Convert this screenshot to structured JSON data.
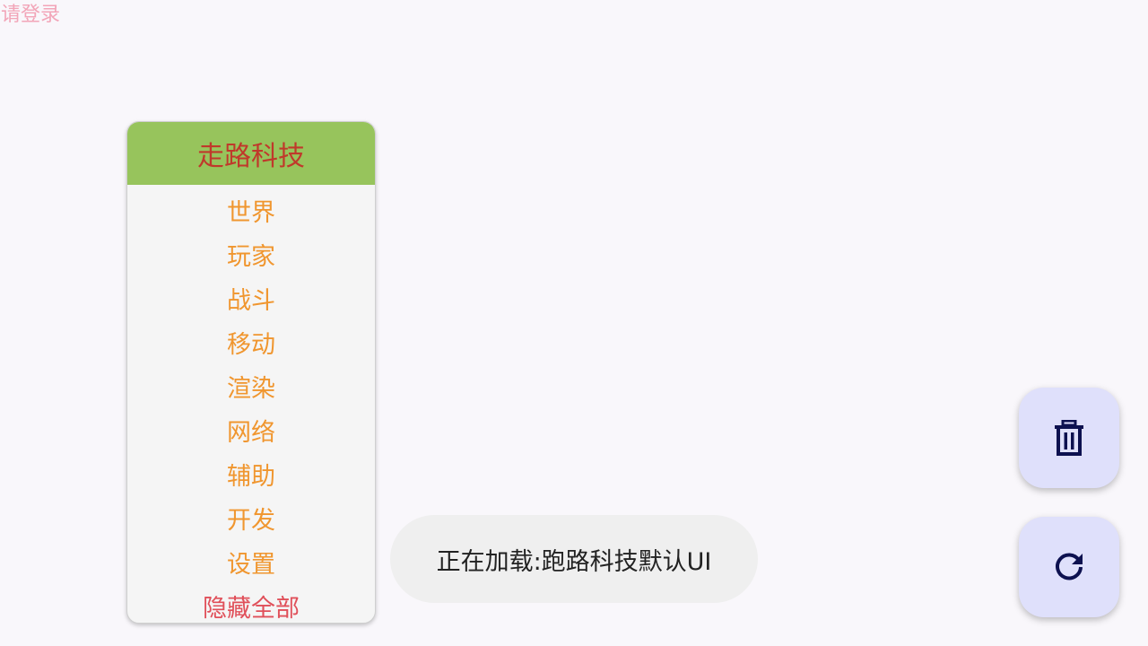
{
  "login_hint": "请登录",
  "menu": {
    "header": "走路科技",
    "items": [
      {
        "label": "世界"
      },
      {
        "label": "玩家"
      },
      {
        "label": "战斗"
      },
      {
        "label": "移动"
      },
      {
        "label": "渲染"
      },
      {
        "label": "网络"
      },
      {
        "label": "辅助"
      },
      {
        "label": "开发"
      },
      {
        "label": "设置"
      },
      {
        "label": "隐藏全部"
      }
    ]
  },
  "toast": {
    "text": "正在加载:跑路科技默认UI"
  },
  "fabs": {
    "delete_icon": "trash-icon",
    "refresh_icon": "refresh-icon"
  },
  "colors": {
    "header_bg": "#97c45c",
    "header_text": "#c0392b",
    "item_text": "#f0962f",
    "hide_all_text": "#e0505a",
    "login_hint": "#f2a5b8",
    "fab_bg": "#dfe0fb",
    "fab_icon": "#0d1150"
  }
}
